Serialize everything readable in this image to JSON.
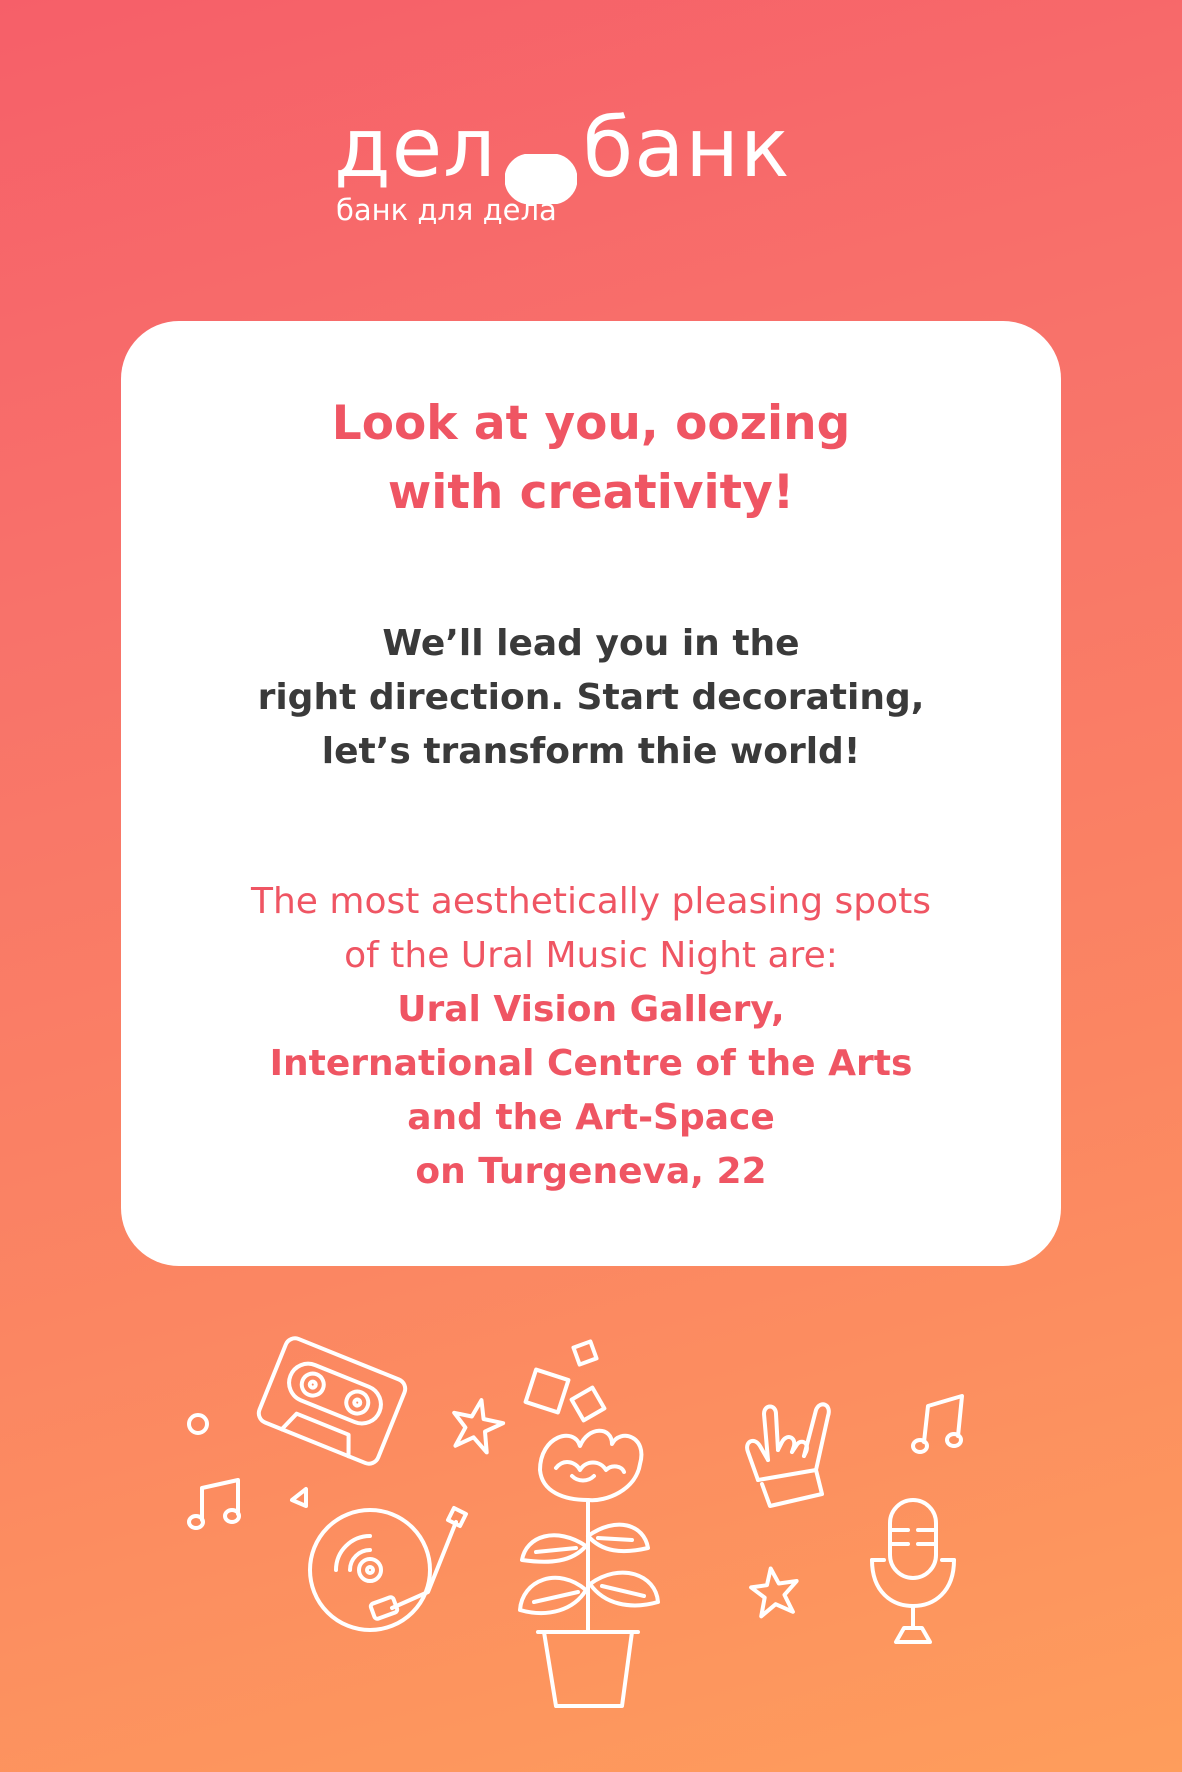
{
  "brand": {
    "logo_left": "дел",
    "logo_right": "банк",
    "tagline": "банк для дела"
  },
  "card": {
    "headline_lines": [
      "Look at you, oozing",
      "with creativity!"
    ],
    "subhead_lines": [
      "We’ll lead you in the",
      "right direction. Start decorating,",
      "let’s transform thie world!"
    ],
    "spots_intro_lines": [
      "The most aesthetically pleasing spots",
      "of the Ural Music Night are:"
    ],
    "spots_bold_lines": [
      "Ural Vision Gallery,",
      "International Centre of the Arts",
      "and the Art-Space",
      "on Turgeneva, 22"
    ]
  },
  "doodles": [
    "cassette-icon",
    "circle-icon",
    "star-icon",
    "music-note-icon",
    "triangle-icon",
    "turntable-icon",
    "flower-pot-icon",
    "rock-hand-icon",
    "microphone-icon"
  ],
  "colors": {
    "gradient_top": "#f65f69",
    "gradient_bottom": "#fe9d5c",
    "accent": "#ef5563",
    "body_text": "#3a3a3a",
    "card": "#ffffff"
  }
}
